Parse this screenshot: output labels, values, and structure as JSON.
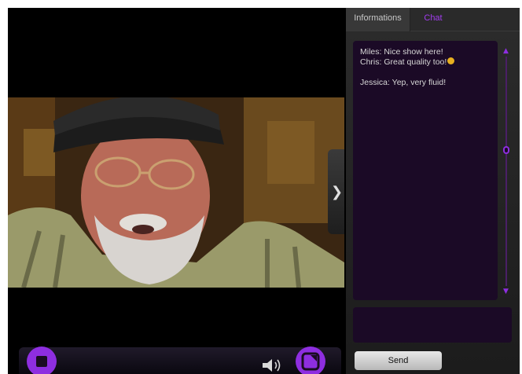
{
  "video": {
    "side_toggle_icon": "chevron-right-icon",
    "controls": {
      "stop_icon": "stop-icon",
      "volume_icon": "volume-icon",
      "fullscreen_icon": "fullscreen-icon"
    }
  },
  "panel": {
    "tabs": [
      {
        "label": "Informations",
        "active": false
      },
      {
        "label": "Chat",
        "active": true
      }
    ],
    "chat": {
      "messages": [
        {
          "text": "Miles: Nice show here!"
        },
        {
          "text": "Chris: Great quality too!",
          "emoji": "smiley-emoji-icon"
        },
        {
          "text": "Jessica: Yep, very fluid!"
        }
      ],
      "input_value": "",
      "send_label": "Send"
    }
  },
  "colors": {
    "accent": "#8e2ee0",
    "chat_background": "#1b0a26",
    "active_tab_text": "#a23cf0"
  }
}
